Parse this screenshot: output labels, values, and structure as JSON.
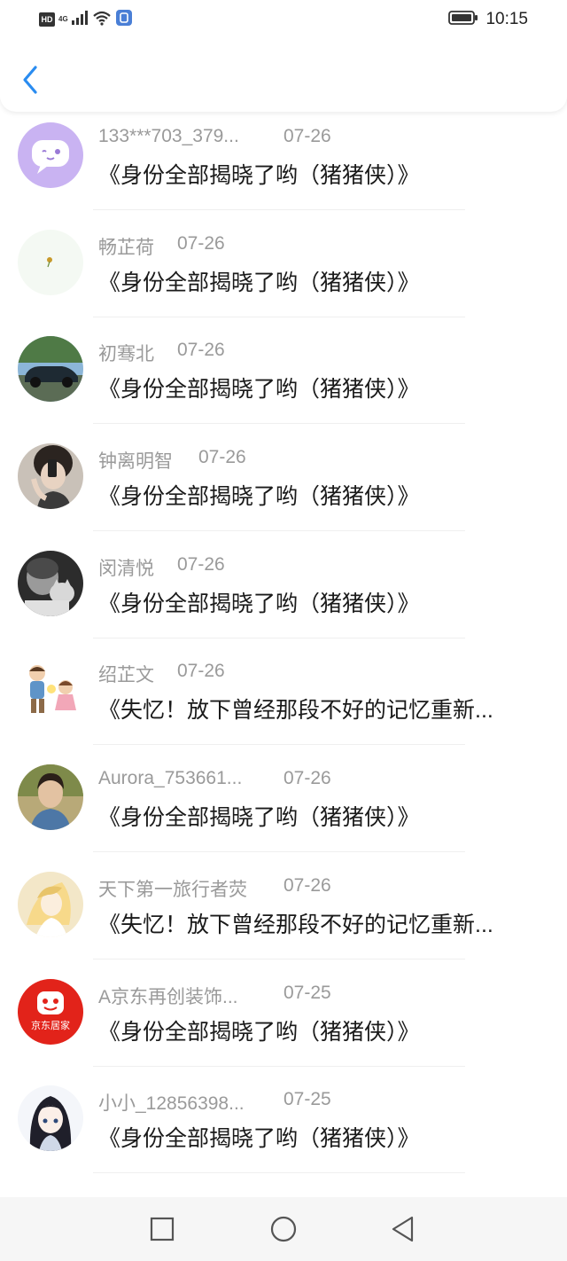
{
  "statusbar": {
    "hd_label": "HD",
    "network_label": "4G",
    "time": "10:15"
  },
  "header": {
    "back_icon": "chevron-left-icon"
  },
  "colors": {
    "accent": "#2a8cf0",
    "meta_text": "#9a9a9a",
    "title_text": "#1a1a1a"
  },
  "items": [
    {
      "name": "133***703_379...",
      "date": "07-26",
      "title": "《身份全部揭晓了哟（猪猪侠）》",
      "avatar": "purple-chat-bubble"
    },
    {
      "name": "畅芷荷",
      "date": "07-26",
      "title": "《身份全部揭晓了哟（猪猪侠）》",
      "avatar": "dandelion"
    },
    {
      "name": "初骞北",
      "date": "07-26",
      "title": "《身份全部揭晓了哟（猪猪侠）》",
      "avatar": "vintage-car"
    },
    {
      "name": "钟离明智",
      "date": "07-26",
      "title": "《身份全部揭晓了哟（猪猪侠）》",
      "avatar": "selfie-photo"
    },
    {
      "name": "闵清悦",
      "date": "07-26",
      "title": "《身份全部揭晓了哟（猪猪侠）》",
      "avatar": "child-with-cat"
    },
    {
      "name": "绍芷文",
      "date": "07-26",
      "title": "《失忆！放下曾经那段不好的记忆重新...",
      "avatar": "cartoon-kids"
    },
    {
      "name": "Aurora_753661...",
      "date": "07-26",
      "title": "《身份全部揭晓了哟（猪猪侠）》",
      "avatar": "young-man-portrait"
    },
    {
      "name": "天下第一旅行者荧",
      "date": "07-26",
      "title": "《失忆！放下曾经那段不好的记忆重新...",
      "avatar": "anime-traveler"
    },
    {
      "name": "A京东再创装饰...",
      "date": "07-25",
      "title": "《身份全部揭晓了哟（猪猪侠）》",
      "avatar": "jd-home-logo",
      "avatar_text": "京东居家"
    },
    {
      "name": "小小_12856398...",
      "date": "07-25",
      "title": "《身份全部揭晓了哟（猪猪侠）》",
      "avatar": "anime-girl"
    }
  ]
}
